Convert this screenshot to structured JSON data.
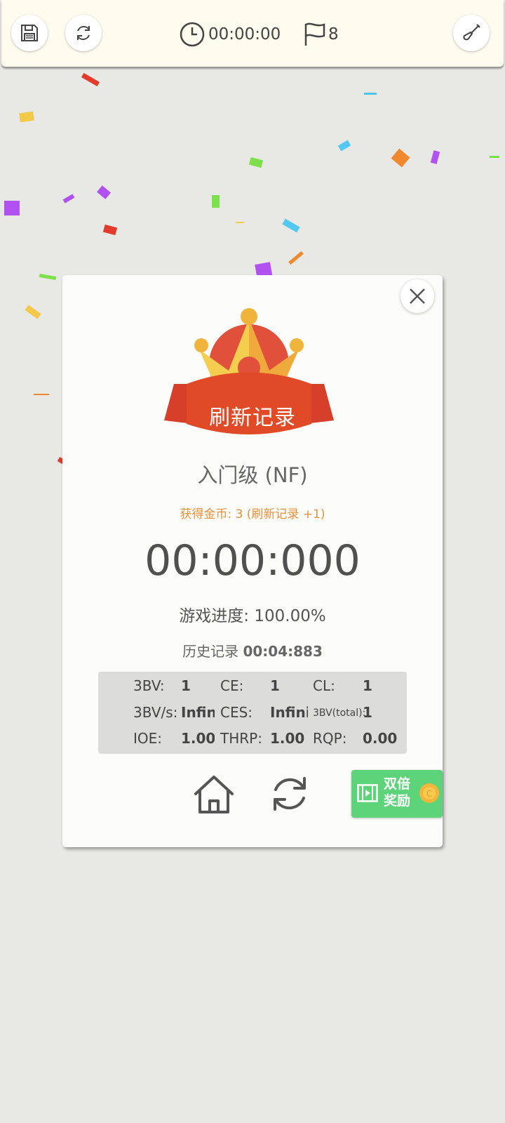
{
  "toolbar": {
    "timer": "00:00:00",
    "flags": "8"
  },
  "dialog": {
    "banner": "刷新记录",
    "level": "入门级 (NF)",
    "coins": "获得金币: 3 (刷新记录 +1)",
    "time": "00:00:000",
    "progress_label": "游戏进度:",
    "progress_value": "100.00%",
    "history_label": "历史记录",
    "history_value": "00:04:883",
    "stats": {
      "bv_label": "3BV:",
      "bv_value": "1",
      "ce_label": "CE:",
      "ce_value": "1",
      "cl_label": "CL:",
      "cl_value": "1",
      "bvs_label": "3BV/s:",
      "bvs_value": "Infini",
      "ces_label": "CES:",
      "ces_value": "Infinit",
      "bvtotal_label": "3BV(total):",
      "bvtotal_value": "1",
      "ioe_label": "IOE:",
      "ioe_value": "1.00",
      "thrp_label": "THRP:",
      "thrp_value": "1.00",
      "rqp_label": "RQP:",
      "rqp_value": "0.00"
    },
    "double_reward_label": "双倍\n奖励"
  },
  "icons": {
    "save": "save-icon",
    "restart": "refresh-icon",
    "clock": "clock-icon",
    "flag": "flag-icon",
    "shovel": "shovel-icon",
    "close": "close-icon",
    "home": "home-icon",
    "replay": "replay-icon",
    "video": "video-icon",
    "coin": "coin-icon"
  },
  "colors": {
    "topbar_bg": "#fefcef",
    "page_bg": "#e8e8e4",
    "coins_text": "#e8903a",
    "ribbon": "#e04a26",
    "crown": "#f3b33c",
    "double_btn": "#5ed47a"
  }
}
